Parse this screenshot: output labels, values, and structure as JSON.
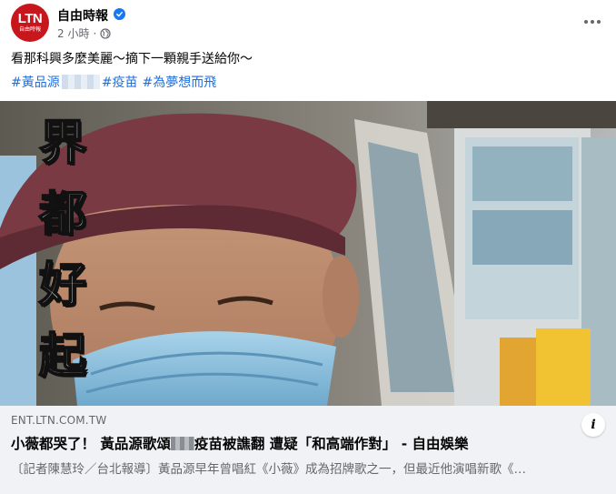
{
  "page": {
    "name": "自由時報",
    "avatar_text": "LTN",
    "avatar_sub": "自由時報",
    "time": "2 小時",
    "separator": "·",
    "verified_icon": "verified-badge-icon",
    "privacy_icon": "globe-icon"
  },
  "post": {
    "text": "看那科興多麼美麗～摘下一顆親手送給你～",
    "hashtags": [
      "#黃品源",
      "#疫苗",
      "#為夢想而飛"
    ]
  },
  "media": {
    "overlay_chars": [
      "界",
      "都",
      "好",
      "起"
    ]
  },
  "link": {
    "domain": "ENT.LTN.COM.TW",
    "headline_prefix": "小薇都哭了！ 黃品源歌頌",
    "headline_suffix": "疫苗被譙翻 遭疑「和高端作對」 - 自由娛樂",
    "description": "〔記者陳慧玲／台北報導〕黃品源早年曾唱紅《小薇》成為招牌歌之一，但最近他演唱新歌《…",
    "info_label": "i"
  },
  "colors": {
    "brand_red": "#c8161d",
    "link_blue": "#216fdb",
    "verified_blue": "#1877f2",
    "muted": "#65676b"
  }
}
